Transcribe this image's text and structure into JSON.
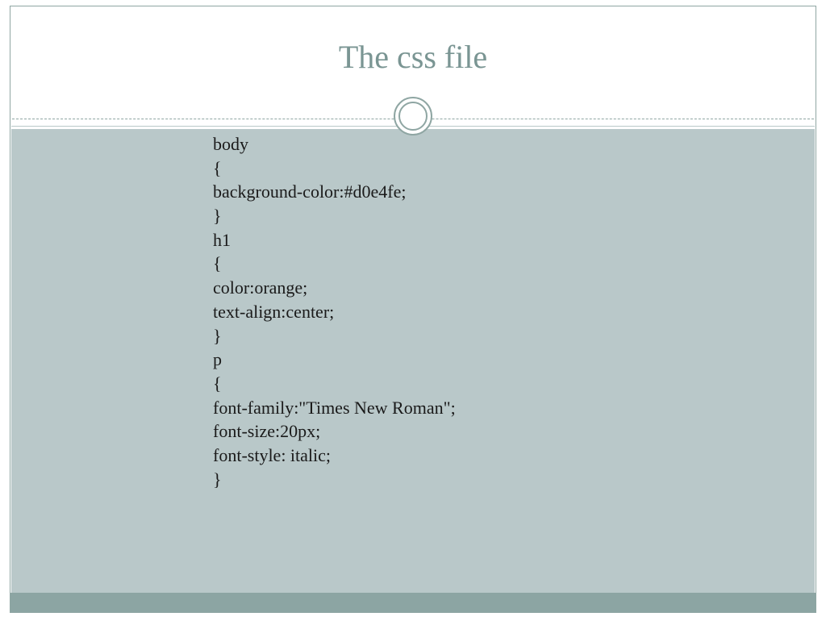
{
  "slide": {
    "title": "The css file",
    "code": "body\n{\nbackground-color:#d0e4fe;\n}\nh1\n{\ncolor:orange;\ntext-align:center;\n}\np\n{\nfont-family:\"Times New Roman\";\nfont-size:20px;\nfont-style: italic;\n}"
  }
}
